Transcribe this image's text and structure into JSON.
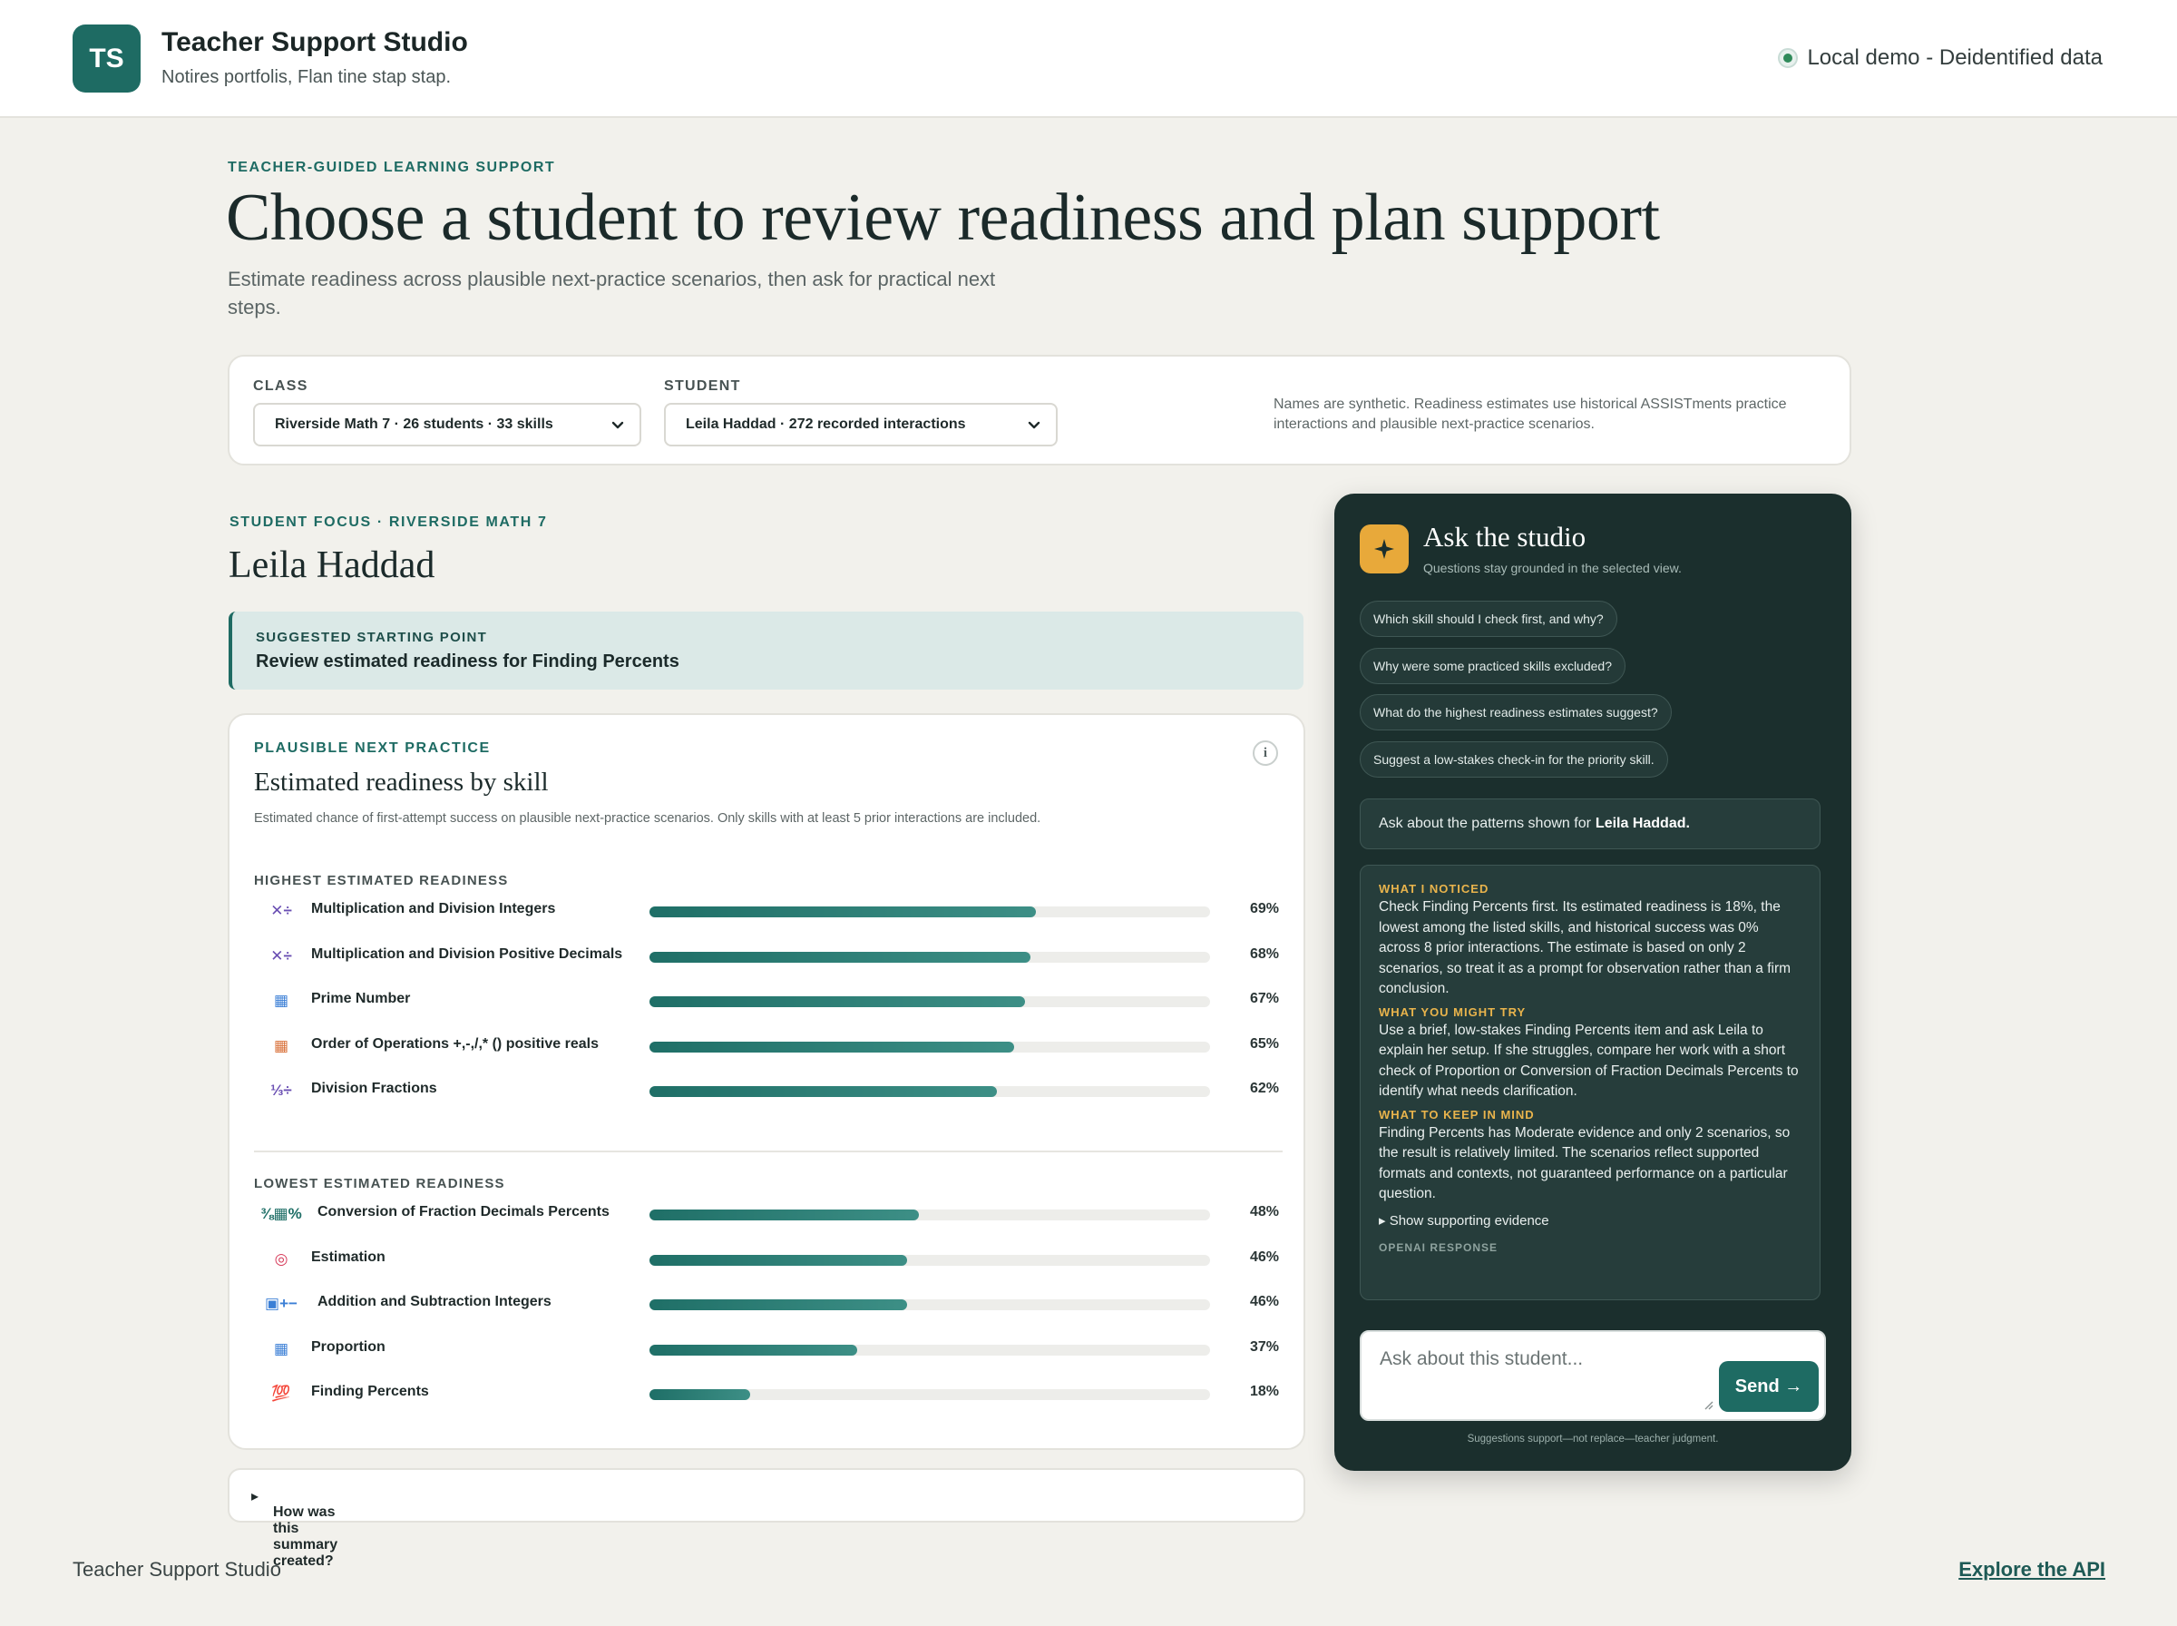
{
  "app": {
    "logo_initials": "TS",
    "title": "Teacher Support Studio",
    "subtitle": "Notires portfolis, Flan tine stap stap.",
    "environment": "Local demo - Deidentified data"
  },
  "hero": {
    "eyebrow": "TEACHER-GUIDED LEARNING SUPPORT",
    "headline": "Choose a student to review readiness and plan support",
    "lede": "Estimate readiness across plausible next-practice scenarios, then ask for practical next steps."
  },
  "filters": {
    "class_label": "CLASS",
    "class_value": "Riverside Math 7 · 26 students · 33 skills",
    "student_label": "STUDENT",
    "student_value": "Leila Haddad · 272 recorded interactions",
    "note": "Names are synthetic. Readiness estimates use historical ASSISTments practice interactions and plausible next-practice scenarios."
  },
  "focus": {
    "eyebrow": "STUDENT FOCUS · RIVERSIDE MATH 7",
    "student_name": "Leila Haddad",
    "suggest_eyebrow": "SUGGESTED STARTING POINT",
    "suggest_text": "Review estimated readiness for Finding Percents"
  },
  "readiness": {
    "eyebrow": "PLAUSIBLE NEXT PRACTICE",
    "title": "Estimated readiness by skill",
    "description": "Estimated chance of first-attempt success on plausible next-practice scenarios. Only skills with at least 5 prior interactions are included.",
    "info_glyph": "i",
    "highest_label": "HIGHEST ESTIMATED READINESS",
    "lowest_label": "LOWEST ESTIMATED READINESS",
    "highest": [
      {
        "name": "Multiplication and Division Integers",
        "value": 0.69,
        "pct": "69%",
        "icon": "multiply-divide-icon",
        "glyph": "✕÷",
        "color": "#6a4fb3"
      },
      {
        "name": "Multiplication and Division Positive Decimals",
        "value": 0.68,
        "pct": "68%",
        "icon": "multiply-divide-icon",
        "glyph": "✕÷",
        "color": "#6a4fb3"
      },
      {
        "name": "Prime Number",
        "value": 0.67,
        "pct": "67%",
        "icon": "number-grid-icon",
        "glyph": "▦",
        "color": "#3b7fd6"
      },
      {
        "name": "Order of Operations +,-,/,* () positive reals",
        "value": 0.65,
        "pct": "65%",
        "icon": "abacus-icon",
        "glyph": "▦",
        "color": "#d9713a"
      },
      {
        "name": "Division Fractions",
        "value": 0.62,
        "pct": "62%",
        "icon": "fraction-divide-icon",
        "glyph": "⅓÷",
        "color": "#6a4fb3"
      }
    ],
    "lowest": [
      {
        "name": "Conversion of Fraction Decimals Percents",
        "value": 0.48,
        "pct": "48%",
        "icon": "fraction-decimal-percent-icon",
        "glyph": "⅜▦%",
        "color": "#1f6f67"
      },
      {
        "name": "Estimation",
        "value": 0.46,
        "pct": "46%",
        "icon": "target-icon",
        "glyph": "◎",
        "color": "#d63b5a"
      },
      {
        "name": "Addition and Subtraction Integers",
        "value": 0.46,
        "pct": "46%",
        "icon": "plus-minus-icon",
        "glyph": "▣+−",
        "color": "#3b7fd6"
      },
      {
        "name": "Proportion",
        "value": 0.37,
        "pct": "37%",
        "icon": "number-grid-icon",
        "glyph": "▦",
        "color": "#3b7fd6"
      },
      {
        "name": "Finding Percents",
        "value": 0.18,
        "pct": "18%",
        "icon": "hundred-points-icon",
        "glyph": "💯",
        "color": "#d63b3b"
      }
    ]
  },
  "how": {
    "label": "How was this summary created?"
  },
  "studio": {
    "title": "Ask the studio",
    "subtitle": "Questions stay grounded in the selected view.",
    "chips": [
      "Which skill should I check first, and why?",
      "Why were some practiced skills excluded?",
      "What do the highest readiness estimates suggest?",
      "Suggest a low-stakes check-in for the priority skill."
    ],
    "prompt_prefix": "Ask about the patterns shown for",
    "prompt_student": "Leila Haddad.",
    "noticed_h": "WHAT I NOTICED",
    "noticed_p": "Check Finding Percents first. Its estimated readiness is 18%, the lowest among the listed skills, and historical success was 0% across 8 prior interactions. The estimate is based on only 2 scenarios, so treat it as a prompt for observation rather than a firm conclusion.",
    "try_h": "WHAT YOU MIGHT TRY",
    "try_p": "Use a brief, low-stakes Finding Percents item and ask Leila to explain her setup. If she struggles, compare her work with a short check of Proportion or Conversion of Fraction Decimals Percents to identify what needs clarification.",
    "keep_h": "WHAT TO KEEP IN MIND",
    "keep_p": "Finding Percents has Moderate evidence and only 2 scenarios, so the result is relatively limited. The scenarios reflect supported formats and contexts, not guaranteed performance on a particular question.",
    "show_evidence": "Show supporting evidence",
    "response_source": "OPENAI RESPONSE",
    "input_placeholder": "Ask about this student...",
    "send_label": "Send →",
    "footnote": "Suggestions support—not replace—teacher judgment."
  },
  "footer": {
    "left": "Teacher Support Studio",
    "right": "Explore the API"
  }
}
